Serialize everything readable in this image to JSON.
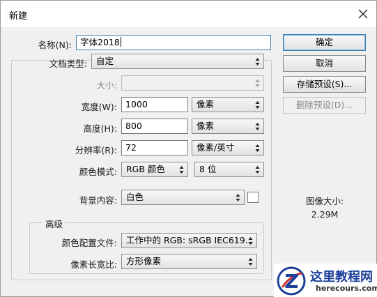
{
  "window": {
    "title": "新建"
  },
  "form": {
    "name": {
      "label": "名称(N):",
      "value": "字体2018"
    },
    "doc_type": {
      "label": "文档类型:",
      "value": "自定"
    },
    "size": {
      "label": "大小:",
      "value": ""
    },
    "width": {
      "label": "宽度(W):",
      "value": "1000",
      "unit": "像素"
    },
    "height": {
      "label": "高度(H):",
      "value": "800",
      "unit": "像素"
    },
    "resolution": {
      "label": "分辨率(R):",
      "value": "72",
      "unit": "像素/英寸"
    },
    "color_mode": {
      "label": "颜色模式:",
      "value": "RGB 颜色",
      "bits": "8 位"
    },
    "background": {
      "label": "背景内容:",
      "value": "白色",
      "swatch": "#ffffff"
    }
  },
  "advanced": {
    "title": "高级",
    "profile": {
      "label": "颜色配置文件:",
      "value": "工作中的 RGB: sRGB IEC619..."
    },
    "aspect": {
      "label": "像素长宽比:",
      "value": "方形像素"
    }
  },
  "buttons": {
    "ok": "确定",
    "cancel": "取消",
    "save_preset": "存储预设(S)...",
    "delete_preset": "删除预设(D)..."
  },
  "image_size": {
    "label": "图像大小:",
    "value": "2.29M"
  },
  "watermark": {
    "title": "这里教程网",
    "url": "herecours.com"
  },
  "colors": {
    "accent": "#3c7fb1",
    "watermark_blue": "#1c3f9a",
    "watermark_red": "#d0302a"
  }
}
